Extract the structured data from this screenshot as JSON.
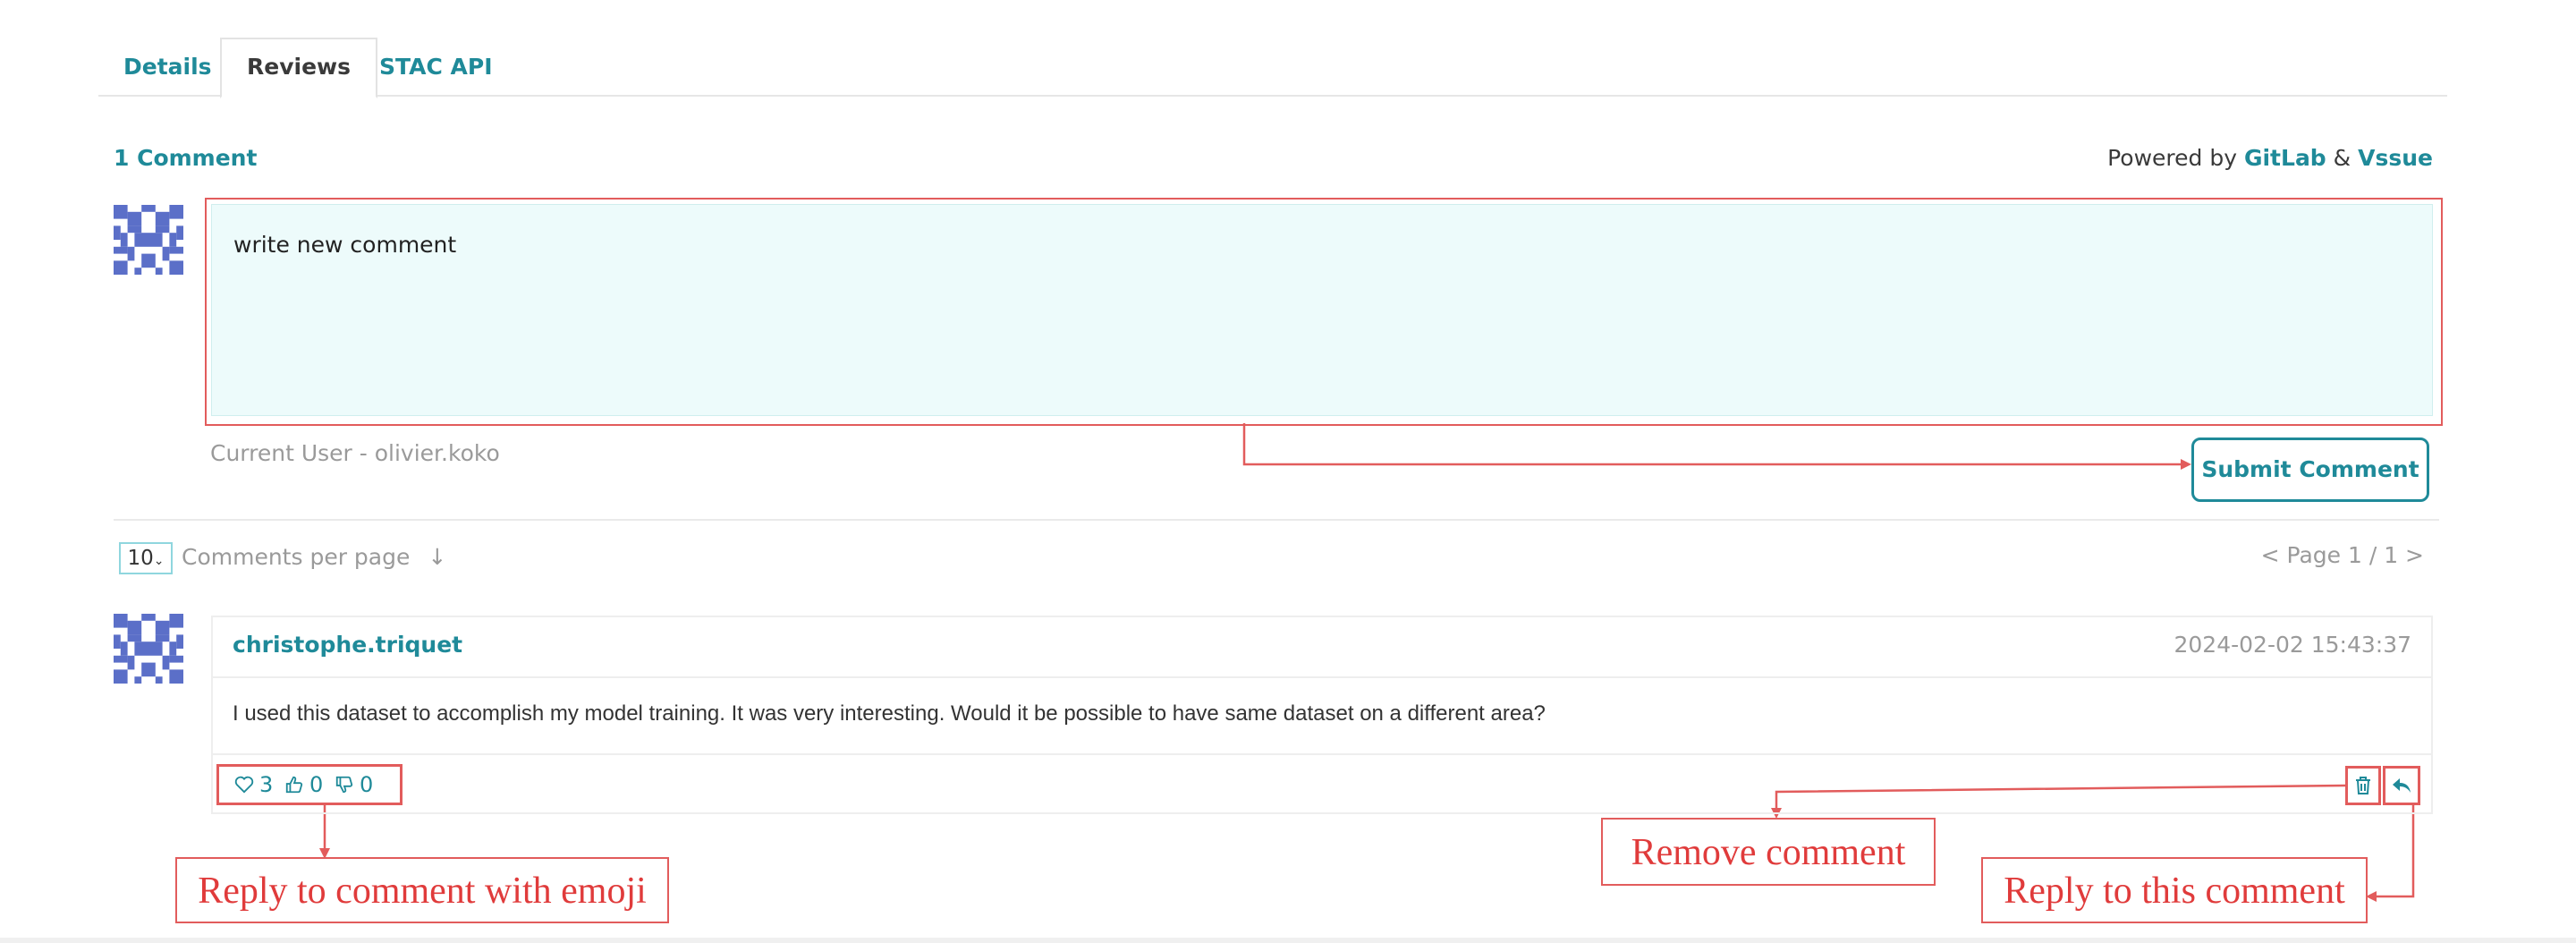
{
  "tabs": [
    {
      "label": "Details",
      "active": false
    },
    {
      "label": "Reviews",
      "active": true
    },
    {
      "label": "STAC API",
      "active": false
    }
  ],
  "header": {
    "comment_count": "1 Comment",
    "powered_prefix": "Powered by",
    "powered_gitlab": "GitLab",
    "powered_amp": "&",
    "powered_vssue": "Vssue"
  },
  "editor": {
    "placeholder": "write new comment",
    "current_user": "Current User - olivier.koko",
    "submit_label": "Submit Comment"
  },
  "pagination": {
    "per_page_value": "10",
    "per_page_label": "Comments per page",
    "sort_arrow": "↓",
    "page_text": "< Page 1 / 1 >"
  },
  "comments": [
    {
      "author": "christophe.triquet",
      "date": "2024-02-02 15:43:37",
      "body": "I used this dataset to accomplish my model training. It was very interesting. Would it be possible to have same dataset on a different area?",
      "reactions": {
        "heart": "3",
        "like": "0",
        "unlike": "0"
      }
    }
  ],
  "annotations": {
    "reply_emoji": "Reply to comment with emoji",
    "remove": "Remove comment",
    "reply": "Reply to this comment"
  },
  "colors": {
    "accent": "#1f8a99",
    "annotation": "#e25c5c",
    "avatar": "#5b6fc8",
    "editor_bg": "#edfbfb"
  },
  "icons": [
    "heart-icon",
    "thumbs-up-icon",
    "thumbs-down-icon",
    "trash-icon",
    "reply-icon",
    "chevron-down-icon",
    "avatar-identicon"
  ]
}
